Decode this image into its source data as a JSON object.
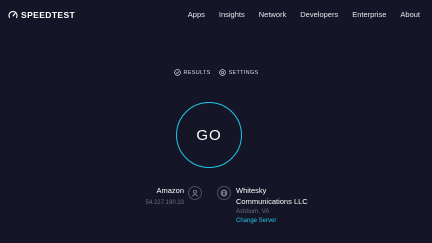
{
  "header": {
    "logo_text": "SPEEDTEST",
    "nav": [
      "Apps",
      "Insights",
      "Network",
      "Developers",
      "Enterprise",
      "About"
    ]
  },
  "subnav": {
    "results_label": "RESULTS",
    "settings_label": "SETTINGS"
  },
  "go_button": {
    "label": "GO"
  },
  "isp": {
    "name": "Amazon",
    "ip": "54.227.190.33"
  },
  "server": {
    "name_line1": "Whitesky",
    "name_line2": "Communications LLC",
    "location": "Ashburn, VA",
    "change_label": "Change Server"
  },
  "colors": {
    "background": "#141526",
    "accent": "#1fc8e6",
    "muted": "#6b6e86"
  }
}
